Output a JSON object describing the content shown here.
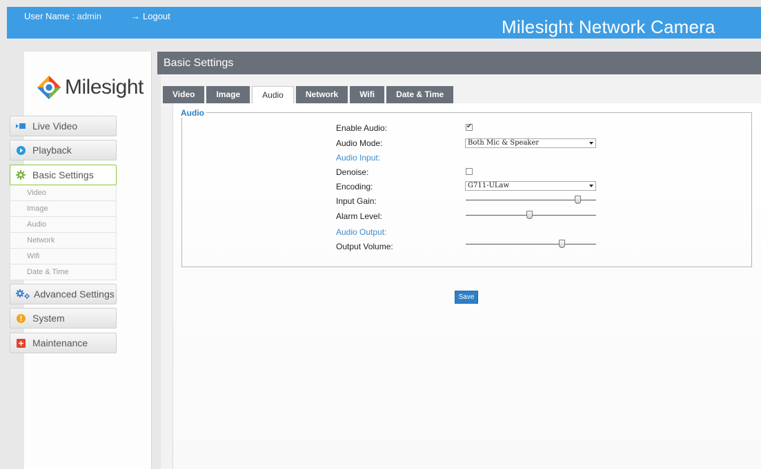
{
  "header": {
    "user_label": "User Name :",
    "user_value": "admin",
    "logout_label": "Logout",
    "brand": "Milesight Network Camera",
    "color": "#3d9de4"
  },
  "sidebar": {
    "logo_text": "Milesight",
    "nav": [
      {
        "label": "Live Video",
        "icon": "video-icon",
        "color": "#2e8bdc"
      },
      {
        "label": "Playback",
        "icon": "play-icon",
        "color": "#2a9ad6"
      },
      {
        "label": "Basic Settings",
        "icon": "gear-icon",
        "color": "#7cb342",
        "active": true
      },
      {
        "label": "Advanced Settings",
        "icon": "gears-icon",
        "color": "#3d7fc9"
      },
      {
        "label": "System",
        "icon": "warning-icon",
        "color": "#f0a41c"
      },
      {
        "label": "Maintenance",
        "icon": "plus-icon",
        "color": "#e0452c"
      }
    ],
    "sub_items": [
      "Video",
      "Image",
      "Audio",
      "Network",
      "Wifi",
      "Date & Time"
    ]
  },
  "main": {
    "title": "Basic Settings",
    "tabs": [
      {
        "label": "Video"
      },
      {
        "label": "Image"
      },
      {
        "label": "Audio",
        "active": true
      },
      {
        "label": "Network"
      },
      {
        "label": "Wifi"
      },
      {
        "label": "Date & Time"
      }
    ],
    "section_title": "Audio",
    "fields": {
      "enable_audio": {
        "label": "Enable Audio:",
        "checked": true
      },
      "audio_mode": {
        "label": "Audio Mode:",
        "value": "Both Mic & Speaker"
      },
      "audio_input_heading": "Audio Input:",
      "denoise": {
        "label": "Denoise:",
        "checked": false
      },
      "encoding": {
        "label": "Encoding:",
        "value": "G711-ULaw"
      },
      "input_gain": {
        "label": "Input Gain:",
        "level": 0.86
      },
      "alarm_level": {
        "label": "Alarm Level:",
        "level": 0.49
      },
      "audio_output_heading": "Audio Output:",
      "output_volume": {
        "label": "Output Volume:",
        "level": 0.74
      }
    },
    "save_label": "Save"
  }
}
